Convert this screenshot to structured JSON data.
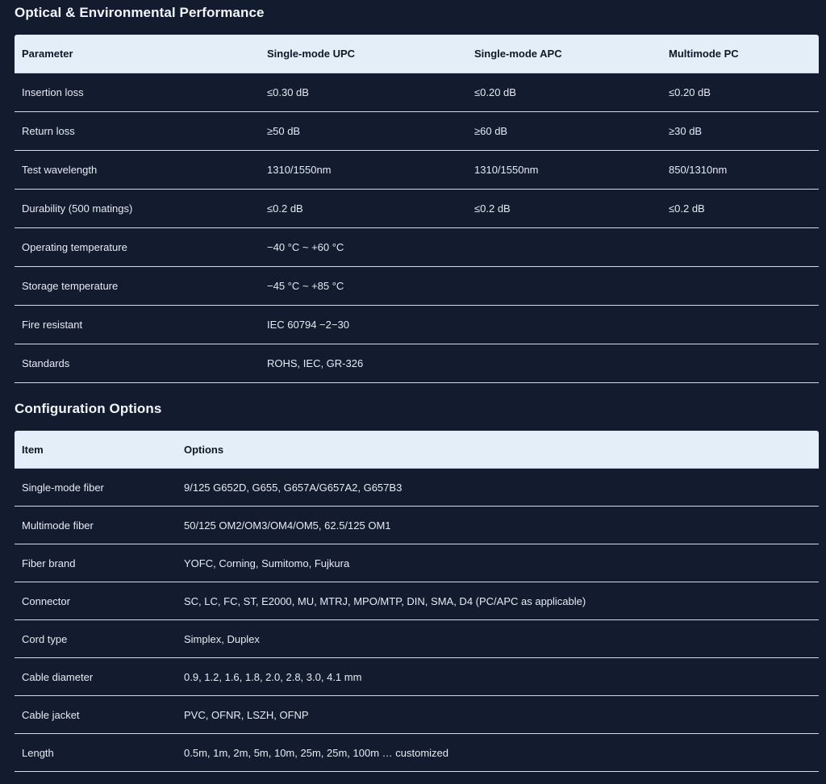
{
  "optical": {
    "title": "Optical & Environmental Performance",
    "headers": [
      "Parameter",
      "Single-mode UPC",
      "Single-mode APC",
      "Multimode PC"
    ],
    "rows": [
      [
        "Insertion loss",
        "≤0.30 dB",
        "≤0.20 dB",
        "≤0.20 dB"
      ],
      [
        "Return loss",
        "≥50 dB",
        "≥60 dB",
        "≥30 dB"
      ],
      [
        "Test wavelength",
        "1310/1550nm",
        "1310/1550nm",
        "850/1310nm"
      ],
      [
        "Durability (500 matings)",
        "≤0.2 dB",
        "≤0.2 dB",
        "≤0.2 dB"
      ],
      [
        "Operating temperature",
        "−40 °C ~ +60 °C",
        "",
        ""
      ],
      [
        "Storage temperature",
        "−45 °C ~ +85 °C",
        "",
        ""
      ],
      [
        "Fire resistant",
        "IEC 60794 −2−30",
        "",
        ""
      ],
      [
        "Standards",
        "ROHS, IEC, GR-326",
        "",
        ""
      ]
    ]
  },
  "config": {
    "title": "Configuration Options",
    "headers": [
      "Item",
      "Options"
    ],
    "rows": [
      [
        "Single-mode fiber",
        "9/125 G652D, G655, G657A/G657A2, G657B3"
      ],
      [
        "Multimode fiber",
        "50/125 OM2/OM3/OM4/OM5, 62.5/125 OM1"
      ],
      [
        "Fiber brand",
        "YOFC, Corning, Sumitomo, Fujkura"
      ],
      [
        "Connector",
        "SC, LC, FC, ST, E2000, MU, MTRJ, MPO/MTP, DIN, SMA, D4 (PC/APC as applicable)"
      ],
      [
        "Cord type",
        "Simplex, Duplex"
      ],
      [
        "Cable diameter",
        "0.9, 1.2, 1.6, 1.8, 2.0, 2.8, 3.0, 4.1 mm"
      ],
      [
        "Cable jacket",
        "PVC, OFNR, LSZH, OFNP"
      ],
      [
        "Length",
        "0.5m, 1m, 2m, 5m, 10m, 25m, 25m, 100m … customized"
      ]
    ]
  }
}
